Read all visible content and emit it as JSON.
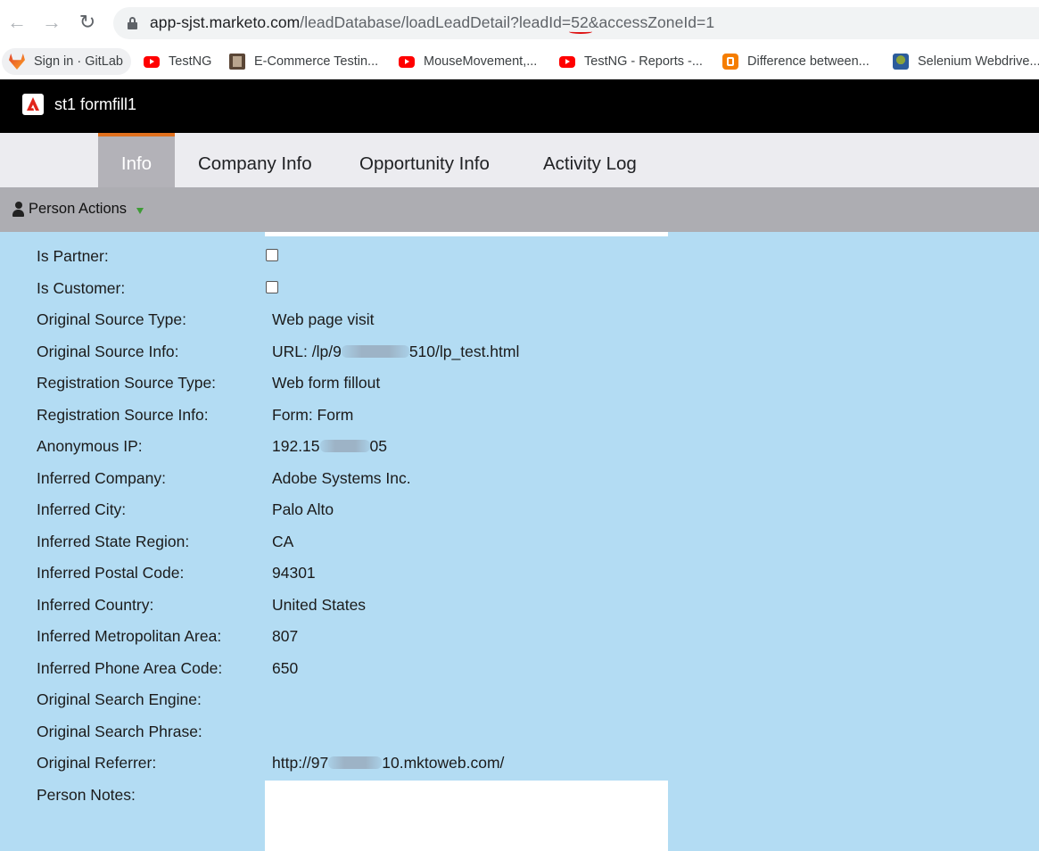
{
  "browser": {
    "url_host": "app-sjst.marketo.com",
    "url_path_before": "/leadDatabase/loadLeadDetail?leadId=",
    "url_lead_id": "52",
    "url_path_after": "&accessZoneId=1",
    "bookmarks": [
      {
        "label": "Sign in · GitLab",
        "icon": "gitlab-icon"
      },
      {
        "label": "TestNG",
        "icon": "youtube-icon"
      },
      {
        "label": "E-Commerce Testin...",
        "icon": "package-icon"
      },
      {
        "label": "MouseMovement,...",
        "icon": "youtube-icon"
      },
      {
        "label": "TestNG - Reports -...",
        "icon": "youtube-icon"
      },
      {
        "label": "Difference between...",
        "icon": "blogger-icon"
      },
      {
        "label": "Selenium Webdrive...",
        "icon": "selenium-icon"
      }
    ]
  },
  "app": {
    "title": "st1 formfill1"
  },
  "tabs": [
    {
      "label": "Info",
      "active": true
    },
    {
      "label": "Company Info",
      "active": false
    },
    {
      "label": "Opportunity Info",
      "active": false
    },
    {
      "label": "Activity Log",
      "active": false
    }
  ],
  "actions": {
    "label": "Person Actions"
  },
  "fields": {
    "is_partner": {
      "label": "Is Partner:",
      "checked": false
    },
    "is_customer": {
      "label": "Is Customer:",
      "checked": false
    },
    "original_source_type": {
      "label": "Original Source Type:",
      "value": "Web page visit"
    },
    "original_source_info": {
      "label": "Original Source Info:",
      "value_prefix": "URL: /lp/9",
      "value_suffix": "510/lp_test.html"
    },
    "registration_source_type": {
      "label": "Registration Source Type:",
      "value": "Web form fillout"
    },
    "registration_source_info": {
      "label": "Registration Source Info:",
      "value": "Form: Form"
    },
    "anonymous_ip": {
      "label": "Anonymous IP:",
      "value_prefix": "192.15",
      "value_suffix": "05"
    },
    "inferred_company": {
      "label": "Inferred Company:",
      "value": "Adobe Systems Inc."
    },
    "inferred_city": {
      "label": "Inferred City:",
      "value": "Palo Alto"
    },
    "inferred_state_region": {
      "label": "Inferred State Region:",
      "value": "CA"
    },
    "inferred_postal_code": {
      "label": "Inferred Postal Code:",
      "value": "94301"
    },
    "inferred_country": {
      "label": "Inferred Country:",
      "value": "United States"
    },
    "inferred_metro_area": {
      "label": "Inferred Metropolitan Area:",
      "value": "807"
    },
    "inferred_phone_area_code": {
      "label": "Inferred Phone Area Code:",
      "value": "650"
    },
    "original_search_engine": {
      "label": "Original Search Engine:",
      "value": ""
    },
    "original_search_phrase": {
      "label": "Original Search Phrase:",
      "value": ""
    },
    "original_referrer": {
      "label": "Original Referrer:",
      "value_prefix": "http://97",
      "value_suffix": "10.mktoweb.com/"
    },
    "person_notes": {
      "label": "Person Notes:",
      "value": ""
    }
  }
}
